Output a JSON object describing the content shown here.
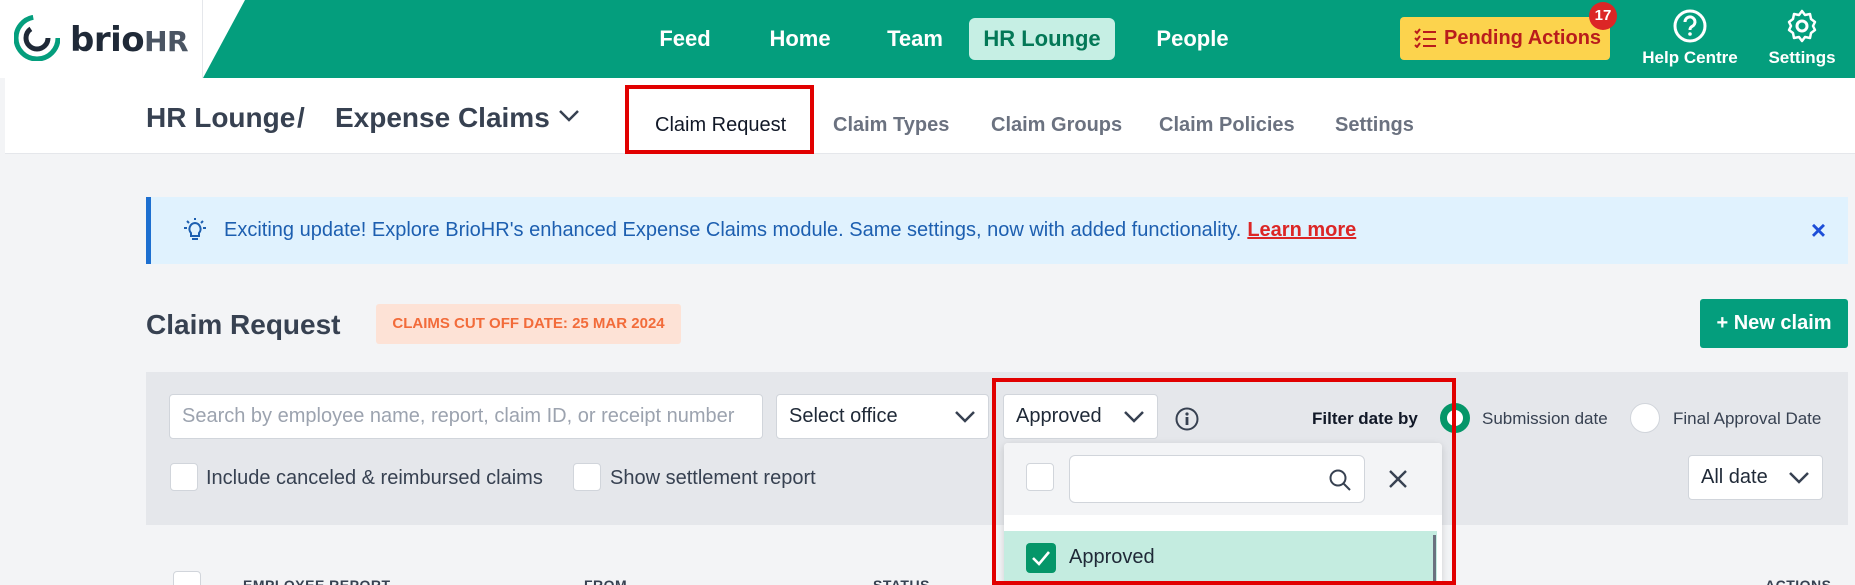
{
  "brand": {
    "name": "brio",
    "suffix": "HR",
    "color": "#049e7d"
  },
  "nav": [
    {
      "label": "Feed",
      "active": false
    },
    {
      "label": "Home",
      "active": false
    },
    {
      "label": "Team",
      "active": false
    },
    {
      "label": "HR Lounge",
      "active": true
    },
    {
      "label": "People",
      "active": false
    }
  ],
  "pending": {
    "label": "Pending Actions",
    "count": "17"
  },
  "help": {
    "label": "Help Centre"
  },
  "settings": {
    "label": "Settings"
  },
  "breadcrumb": {
    "parent": "HR Lounge",
    "separator": "/",
    "current": "Expense Claims"
  },
  "subtabs": [
    {
      "label": "Claim Request",
      "active": true
    },
    {
      "label": "Claim Types",
      "active": false
    },
    {
      "label": "Claim Groups",
      "active": false
    },
    {
      "label": "Claim Policies",
      "active": false
    },
    {
      "label": "Settings",
      "active": false
    }
  ],
  "banner": {
    "text": "Exciting update! Explore BrioHR's enhanced Expense Claims module. Same settings, now with added functionality.",
    "link": "Learn more",
    "close": "×"
  },
  "page": {
    "title": "Claim Request",
    "cutoff": "CLAIMS CUT OFF DATE: 25 MAR 2024",
    "new_claim": "+ New claim"
  },
  "filters": {
    "search_placeholder": "Search by employee name, report, claim ID, or receipt number",
    "office_placeholder": "Select office",
    "status_value": "Approved",
    "filter_date_label": "Filter date by",
    "date_options": [
      {
        "label": "Submission date",
        "selected": true
      },
      {
        "label": "Final Approval Date",
        "selected": false
      }
    ],
    "include_canceled": "Include canceled & reimbursed claims",
    "show_settlement": "Show settlement report",
    "date_range": "All date"
  },
  "status_dropdown": {
    "search_value": "",
    "options": [
      {
        "label": "Approved",
        "checked": true
      }
    ]
  },
  "table_headers": [
    "EMPLOYEE REPORT",
    "FROM",
    "STATUS",
    "ACTIONS"
  ]
}
